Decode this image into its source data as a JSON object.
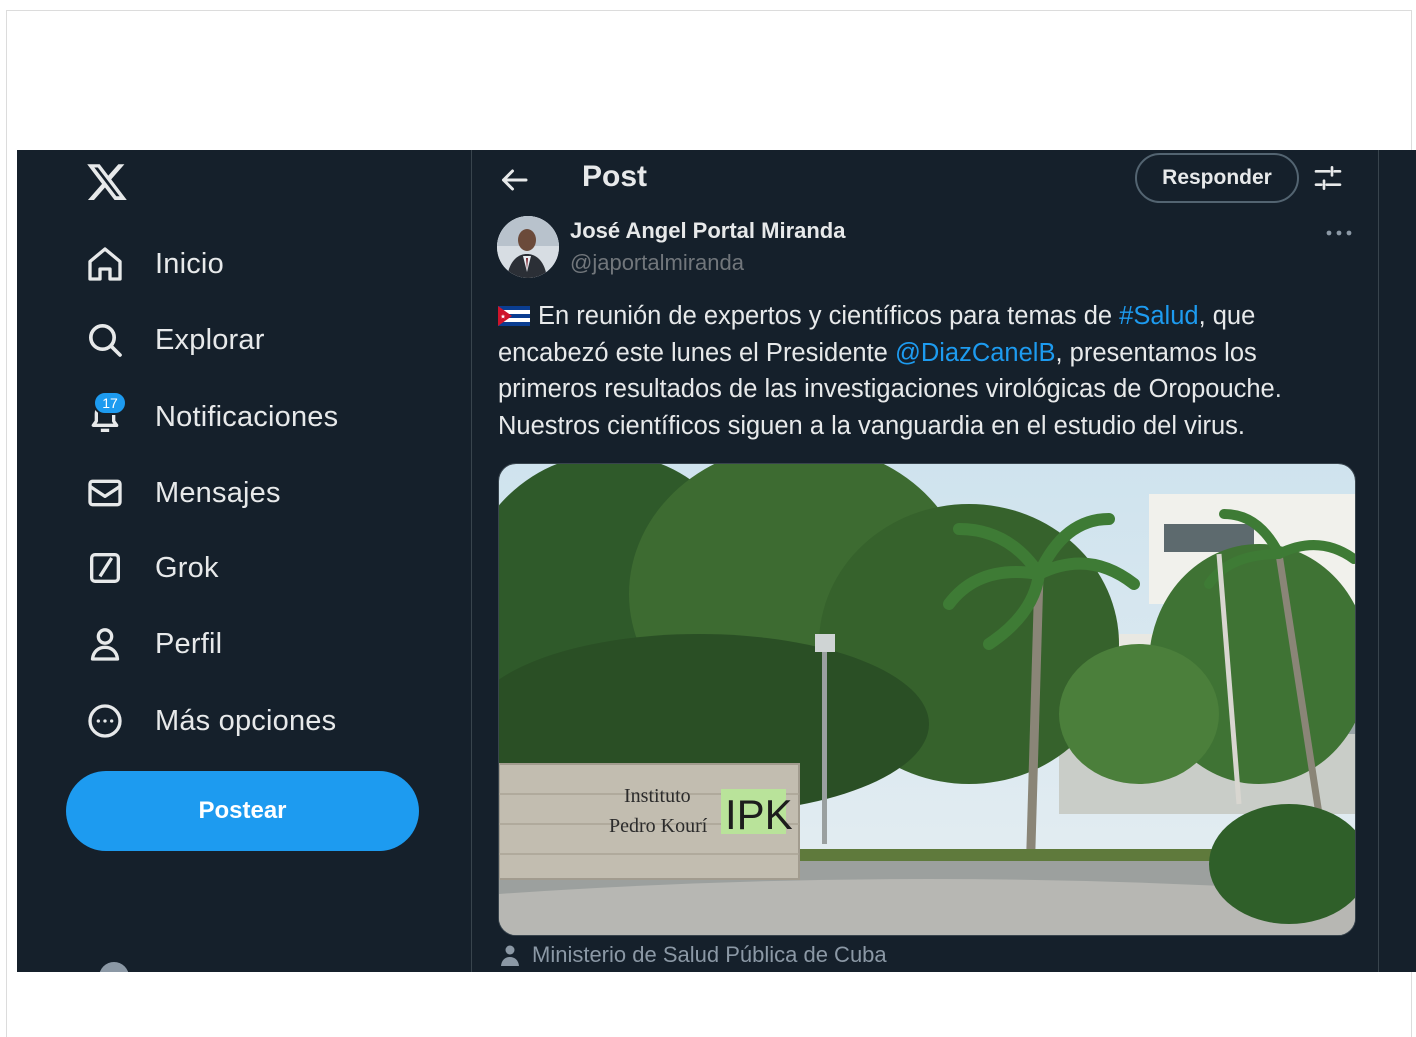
{
  "nav": {
    "items": [
      {
        "label": "Inicio",
        "icon": "home-icon"
      },
      {
        "label": "Explorar",
        "icon": "search-icon"
      },
      {
        "label": "Notificaciones",
        "icon": "bell-icon",
        "badge": "17"
      },
      {
        "label": "Mensajes",
        "icon": "mail-icon"
      },
      {
        "label": "Grok",
        "icon": "grok-icon"
      },
      {
        "label": "Perfil",
        "icon": "person-icon"
      },
      {
        "label": "Más opciones",
        "icon": "more-circle-icon"
      }
    ],
    "post_button": "Postear"
  },
  "header": {
    "title": "Post",
    "reply_button": "Responder"
  },
  "tweet": {
    "author_name": "José Angel Portal Miranda",
    "handle": "@japortalmiranda",
    "text_1": "En reunión de expertos y científicos para temas de ",
    "hashtag": "#Salud",
    "text_2": ", que encabezó este lunes el Presidente ",
    "mention": "@DiazCanelB",
    "text_3": ", presentamos los primeros resultados de las investigaciones virológicas de Oropouche. Nuestros científicos siguen a la vanguardia en el estudio del virus.",
    "photo_sign_line1": "Instituto",
    "photo_sign_line2": "Pedro Kourí",
    "photo_sign_logo": "IPK",
    "photo_credit": "Ministerio de Salud Pública de Cuba"
  },
  "colors": {
    "background": "#15202b",
    "accent": "#1d9bf0",
    "text": "#e7e9ea",
    "muted": "#71767b"
  }
}
